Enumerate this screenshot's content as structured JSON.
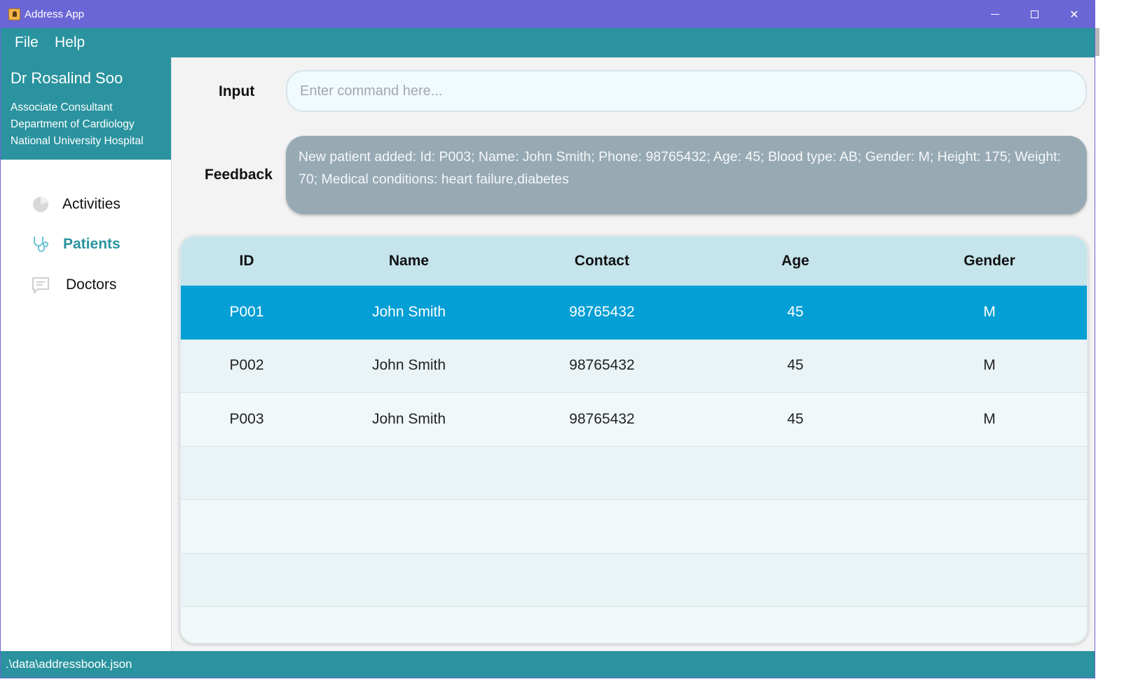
{
  "window": {
    "title": "Address App",
    "icons": {
      "app": "address-book-icon",
      "minimize": "minimize-icon",
      "maximize": "maximize-icon",
      "close": "close-icon"
    },
    "close_glyph": "✕"
  },
  "menu": {
    "file": "File",
    "help": "Help"
  },
  "profile": {
    "name": "Dr Rosalind Soo",
    "title": "Associate Consultant",
    "department": "Department of Cardiology",
    "hospital": "National University Hospital"
  },
  "nav": {
    "activities": "Activities",
    "patients": "Patients",
    "doctors": "Doctors",
    "active": "patients",
    "icons": {
      "activities": "pie-chart-icon",
      "patients": "stethoscope-icon",
      "doctors": "chat-bubble-icon"
    }
  },
  "command": {
    "label": "Input",
    "placeholder": "Enter command here...",
    "value": ""
  },
  "feedback": {
    "label": "Feedback",
    "text": "New patient added: Id: P003; Name: John Smith; Phone: 98765432; Age: 45; Blood type: AB; Gender: M; Height: 175; Weight: 70; Medical conditions: heart failure,diabetes"
  },
  "table": {
    "columns": [
      "ID",
      "Name",
      "Contact",
      "Age",
      "Gender"
    ],
    "rows": [
      {
        "id": "P001",
        "name": "John Smith",
        "contact": "98765432",
        "age": "45",
        "gender": "M",
        "selected": true
      },
      {
        "id": "P002",
        "name": "John Smith",
        "contact": "98765432",
        "age": "45",
        "gender": "M",
        "selected": false
      },
      {
        "id": "P003",
        "name": "John Smith",
        "contact": "98765432",
        "age": "45",
        "gender": "M",
        "selected": false
      }
    ]
  },
  "status": {
    "path": ".\\data\\addressbook.json"
  },
  "colors": {
    "titlebar": "#6b66d6",
    "accent": "#2a939f",
    "selected_row": "#039fd5",
    "header_row": "#c5e4ec",
    "feedback_bg": "#97aab4"
  }
}
